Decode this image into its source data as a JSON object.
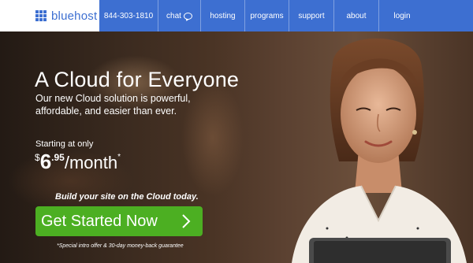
{
  "brand": {
    "name": "bluehost",
    "color": "#3d6fd1"
  },
  "nav": {
    "phone": "844-303-1810",
    "chat": "chat",
    "hosting": "hosting",
    "programs": "programs",
    "support": "support",
    "about": "about",
    "login": "login"
  },
  "hero": {
    "headline": "A Cloud for Everyone",
    "subline": "Our new Cloud solution is powerful, affordable, and easier than ever.",
    "starting": "Starting at only",
    "price": {
      "currency": "$",
      "dollars": "6",
      "cents": ".95",
      "per": "/month",
      "asterisk": "*"
    },
    "build": "Build your site on the Cloud today.",
    "cta": "Get Started Now",
    "disclaimer": "*Special intro offer & 30-day money-back guarantee"
  },
  "colors": {
    "cta": "#4caf22",
    "nav": "#3d6fd1"
  }
}
